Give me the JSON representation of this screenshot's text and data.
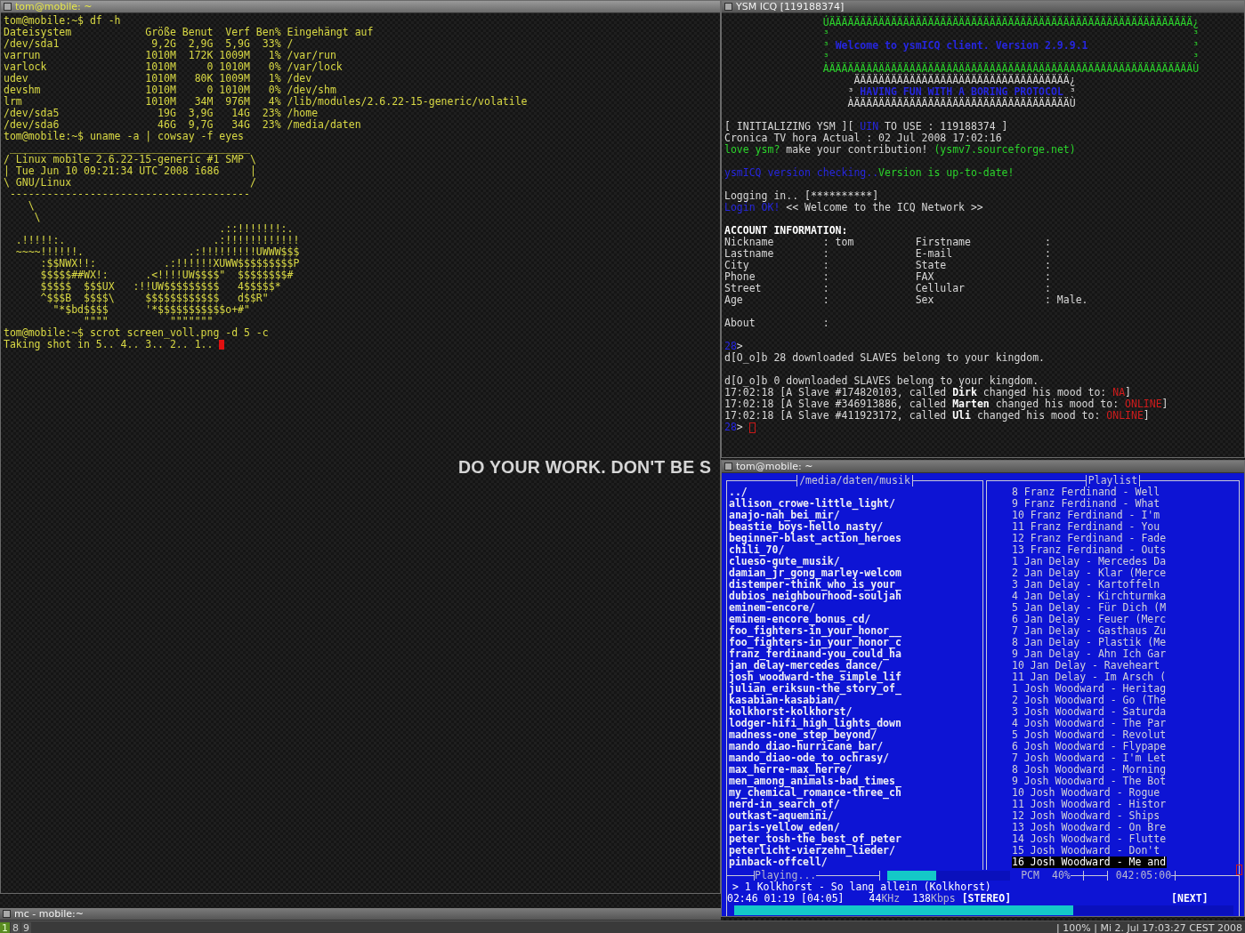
{
  "left_terminal": {
    "title": "tom@mobile: ~",
    "focused": true,
    "lines": [
      "tom@mobile:~$ df -h",
      "Dateisystem            Größe Benut  Verf Ben% Eingehängt auf",
      "/dev/sda1               9,2G  2,9G  5,9G  33% /",
      "varrun                 1010M  172K 1009M   1% /var/run",
      "varlock                1010M     0 1010M   0% /var/lock",
      "udev                   1010M   80K 1009M   1% /dev",
      "devshm                 1010M     0 1010M   0% /dev/shm",
      "lrm                    1010M   34M  976M   4% /lib/modules/2.6.22-15-generic/volatile",
      "/dev/sda5                19G  3,9G   14G  23% /home",
      "/dev/sda6                46G  9,7G   34G  23% /media/daten",
      "tom@mobile:~$ uname -a | cowsay -f eyes",
      " _______________________________________",
      "/ Linux mobile 2.6.22-15-generic #1 SMP \\",
      "| Tue Jun 10 09:21:34 UTC 2008 i686     |",
      "\\ GNU/Linux                             /",
      " ---------------------------------------",
      "    \\",
      "     \\",
      "                                   .::!!!!!!!:.",
      "  .!!!!!:.                        .:!!!!!!!!!!!!",
      "  ~~~~!!!!!!.                 .:!!!!!!!!!UWWW$$$",
      "      :$$NWX!!:           .:!!!!!!XUWW$$$$$$$$$P",
      "      $$$$$##WX!:      .<!!!!UW$$$$\"  $$$$$$$$#",
      "      $$$$$  $$$UX   :!!UW$$$$$$$$$   4$$$$$*",
      "      ^$$$B  $$$$\\     $$$$$$$$$$$$   d$$R\"",
      "        \"*$bd$$$$      '*$$$$$$$$$$$o+#\"",
      "             \"\"\"\"          \"\"\"\"\"\"\"",
      "tom@mobile:~$ scrot screen_voll.png -d 5 -c",
      "Taking shot in 5.. 4.. 3.. 2.. 1.. "
    ]
  },
  "wallpaper": {
    "slogan": "DO YOUR WORK. DON'T BE S"
  },
  "icq": {
    "title": "YSM ICQ [119188374]",
    "focused": false,
    "lines": [
      {
        "kind": "banner",
        "segments": [
          {
            "t": "                ÚÄÄÄÄÄÄÄÄÄÄÄÄÄÄÄÄÄÄÄÄÄÄÄÄÄÄÄÄÄÄÄÄÄÄÄÄÄÄÄÄÄÄÄÄÄÄÄÄÄÄÄÄÄÄÄÄÄÄÄ¿"
          }
        ]
      },
      {
        "kind": "banner",
        "segments": [
          {
            "t": "                ³                                                           ³"
          }
        ]
      },
      {
        "kind": "banner",
        "segments": [
          {
            "t": "                ³ "
          },
          {
            "t": "Welcome to ysmICQ client. Version 2.9.9.1",
            "color": "#2626e0",
            "bold": true
          },
          {
            "t": "                 ³"
          }
        ]
      },
      {
        "kind": "banner",
        "segments": [
          {
            "t": "                ³                                                           ³"
          }
        ]
      },
      {
        "kind": "banner",
        "segments": [
          {
            "t": "                ÀÄÄÄÄÄÄÄÄÄÄÄÄÄÄÄÄÄÄÄÄÄÄÄÄÄÄÄÄÄÄÄÄÄÄÄÄÄÄÄÄÄÄÄÄÄÄÄÄÄÄÄÄÄÄÄÄÄÄÄÙ"
          }
        ]
      },
      {
        "kind": "text",
        "segments": [
          {
            "t": "                     ÄÄÄÄÄÄÄÄÄÄÄÄÄÄÄÄÄÄÄÄÄÄÄÄÄÄÄÄÄÄÄÄÄÄÄ¿"
          }
        ]
      },
      {
        "kind": "text",
        "segments": [
          {
            "t": "                    ³ "
          },
          {
            "t": "HAVING FUN WITH A BORING PROTOCOL",
            "color": "#2626e0",
            "bold": true
          },
          {
            "t": " ³"
          }
        ]
      },
      {
        "kind": "text",
        "segments": [
          {
            "t": "                    ÀÄÄÄÄÄÄÄÄÄÄÄÄÄÄÄÄÄÄÄÄÄÄÄÄÄÄÄÄÄÄÄÄÄÄÄÙ"
          }
        ]
      },
      {
        "kind": "blank"
      },
      {
        "kind": "text",
        "segments": [
          {
            "t": "[ INITIALIZING YSM ][ "
          },
          {
            "t": "UIN",
            "color": "#2626e0"
          },
          {
            "t": " TO USE : 119188374 ]"
          }
        ]
      },
      {
        "kind": "text",
        "segments": [
          {
            "t": "Cronica TV hora Actual : 02 Jul 2008 17:02:16"
          }
        ]
      },
      {
        "kind": "text",
        "segments": [
          {
            "t": "love ysm?",
            "color": "#2bd42b"
          },
          {
            "t": " make your contribution! "
          },
          {
            "t": "(ysmv7.sourceforge.net)",
            "color": "#2bd42b"
          }
        ]
      },
      {
        "kind": "blank"
      },
      {
        "kind": "text",
        "segments": [
          {
            "t": "ysmICQ version checking..",
            "color": "#2626e0"
          },
          {
            "t": "Version is up-to-date!",
            "color": "#2bd42b"
          }
        ]
      },
      {
        "kind": "blank"
      },
      {
        "kind": "text",
        "segments": [
          {
            "t": "Logging in.. [**********]"
          }
        ]
      },
      {
        "kind": "text",
        "segments": [
          {
            "t": "Login OK!",
            "color": "#2626e0"
          },
          {
            "t": " << Welcome to the ICQ Network >>"
          }
        ]
      },
      {
        "kind": "blank"
      },
      {
        "kind": "heading",
        "text": "ACCOUNT INFORMATION:"
      },
      {
        "kind": "text",
        "segments": [
          {
            "t": "Nickname        : tom          Firstname            :"
          }
        ]
      },
      {
        "kind": "text",
        "segments": [
          {
            "t": "Lastname        :              E-mail               :"
          }
        ]
      },
      {
        "kind": "text",
        "segments": [
          {
            "t": "City            :              State                :"
          }
        ]
      },
      {
        "kind": "text",
        "segments": [
          {
            "t": "Phone           :              FAX                  :"
          }
        ]
      },
      {
        "kind": "text",
        "segments": [
          {
            "t": "Street          :              Cellular             :"
          }
        ]
      },
      {
        "kind": "text",
        "segments": [
          {
            "t": "Age             :              Sex                  : Male."
          }
        ]
      },
      {
        "kind": "blank"
      },
      {
        "kind": "text",
        "segments": [
          {
            "t": "About           :"
          }
        ]
      },
      {
        "kind": "blank"
      },
      {
        "kind": "text",
        "segments": [
          {
            "t": "28",
            "color": "#2626e0"
          },
          {
            "t": ">"
          }
        ]
      },
      {
        "kind": "text",
        "segments": [
          {
            "t": "d[O_o]b 28 downloaded SLAVES belong to your kingdom."
          }
        ]
      },
      {
        "kind": "blank"
      },
      {
        "kind": "text",
        "segments": [
          {
            "t": "d[O_o]b 0 downloaded SLAVES belong to your kingdom."
          }
        ]
      },
      {
        "kind": "text",
        "segments": [
          {
            "t": "17:02:18 [A Slave #174820103, called "
          },
          {
            "t": "Dirk",
            "bold": true,
            "color": "#ffffff"
          },
          {
            "t": " changed his mood to: "
          },
          {
            "t": "NA",
            "color": "#d01c1c"
          },
          {
            "t": "]"
          }
        ]
      },
      {
        "kind": "text",
        "segments": [
          {
            "t": "17:02:18 [A Slave #346913886, called "
          },
          {
            "t": "Marten",
            "bold": true,
            "color": "#ffffff"
          },
          {
            "t": " changed his mood to: "
          },
          {
            "t": "ONLINE",
            "color": "#d01c1c"
          },
          {
            "t": "]"
          }
        ]
      },
      {
        "kind": "text",
        "segments": [
          {
            "t": "17:02:18 [A Slave #411923172, called "
          },
          {
            "t": "Uli",
            "bold": true,
            "color": "#ffffff"
          },
          {
            "t": " changed his mood to: "
          },
          {
            "t": "ONLINE",
            "color": "#d01c1c"
          },
          {
            "t": "]"
          }
        ]
      },
      {
        "kind": "prompt",
        "segments": [
          {
            "t": "28",
            "color": "#2626e0"
          },
          {
            "t": "> "
          }
        ]
      }
    ]
  },
  "player": {
    "title": "tom@mobile: ~",
    "focused": false,
    "browser": {
      "path": "/media/daten/musik",
      "items": [
        "../",
        "allison_crowe-little_light/",
        "anajo-nah_bei_mir/",
        "beastie_boys-hello_nasty/",
        "beginner-blast_action_heroes",
        "chili_70/",
        "clueso-gute_musik/",
        "damian_jr_gong_marley-welcom",
        "distemper-think_who_is_your_",
        "dubios_neighbourhood-souljah",
        "eminem-encore/",
        "eminem-encore_bonus_cd/",
        "foo_fighters-in_your_honor__",
        "foo_fighters-in_your_honor_c",
        "franz_ferdinand-you_could_ha",
        "jan_delay-mercedes_dance/",
        "josh_woodward-the_simple_lif",
        "julian_eriksun-the_story_of_",
        "kasabian-kasabian/",
        "kolkhorst-kolkhorst/",
        "lodger-hifi_high_lights_down",
        "madness-one_step_beyond/",
        "mando_diao-hurricane_bar/",
        "mando_diao-ode_to_ochrasy/",
        "max_herre-max_herre/",
        "men_among_animals-bad_times_",
        "my_chemical_romance-three_ch",
        "nerd-in_search_of/",
        "outkast-aquemini/",
        "paris-yellow_eden/",
        "peter_tosh-the_best_of_peter",
        "peterlicht-vierzehn_lieder/",
        "pinback-offcell/"
      ]
    },
    "playlist": {
      "title": "Playlist",
      "items": [
        {
          "label": "8 Franz Ferdinand - Well",
          "selected": false
        },
        {
          "label": "9 Franz Ferdinand - What",
          "selected": false
        },
        {
          "label": "10 Franz Ferdinand - I'm",
          "selected": false
        },
        {
          "label": "11 Franz Ferdinand - You",
          "selected": false
        },
        {
          "label": "12 Franz Ferdinand - Fade",
          "selected": false
        },
        {
          "label": "13 Franz Ferdinand - Outs",
          "selected": false
        },
        {
          "label": "1 Jan Delay - Mercedes Da",
          "selected": false
        },
        {
          "label": "2 Jan Delay - Klar (Merce",
          "selected": false
        },
        {
          "label": "3 Jan Delay - Kartoffeln",
          "selected": false
        },
        {
          "label": "4 Jan Delay - Kirchturmka",
          "selected": false
        },
        {
          "label": "5 Jan Delay - Für Dich (M",
          "selected": false
        },
        {
          "label": "6 Jan Delay - Feuer (Merc",
          "selected": false
        },
        {
          "label": "7 Jan Delay - Gasthaus Zu",
          "selected": false
        },
        {
          "label": "8 Jan Delay - Plastik (Me",
          "selected": false
        },
        {
          "label": "9 Jan Delay - Ahn Ich Gar",
          "selected": false
        },
        {
          "label": "10 Jan Delay - Raveheart",
          "selected": false
        },
        {
          "label": "11 Jan Delay - Im Arsch (",
          "selected": false
        },
        {
          "label": "1 Josh Woodward - Heritag",
          "selected": false
        },
        {
          "label": "2 Josh Woodward - Go (The",
          "selected": false
        },
        {
          "label": "3 Josh Woodward - Saturda",
          "selected": false
        },
        {
          "label": "4 Josh Woodward - The Par",
          "selected": false
        },
        {
          "label": "5 Josh Woodward - Revolut",
          "selected": false
        },
        {
          "label": "6 Josh Woodward - Flypape",
          "selected": false
        },
        {
          "label": "7 Josh Woodward - I'm Let",
          "selected": false
        },
        {
          "label": "8 Josh Woodward - Morning",
          "selected": false
        },
        {
          "label": "9 Josh Woodward - The Bot",
          "selected": false
        },
        {
          "label": "10 Josh Woodward - Rogue",
          "selected": false
        },
        {
          "label": "11 Josh Woodward - Histor",
          "selected": false
        },
        {
          "label": "12 Josh Woodward - Ships",
          "selected": false
        },
        {
          "label": "13 Josh Woodward - On Bre",
          "selected": false
        },
        {
          "label": "14 Josh Woodward - Flutte",
          "selected": false
        },
        {
          "label": "15 Josh Woodward - Don't",
          "selected": false
        },
        {
          "label": "16 Josh Woodward - Me and",
          "selected": true
        }
      ]
    },
    "status": {
      "title": "Playing...",
      "volume": {
        "level": 0.4,
        "label": "PCM",
        "reading": "40%"
      },
      "total_time": "042:05:00",
      "now_playing": "> 1 Kolkhorst - So lang allein (Kolkhorst)",
      "times": "02:46 01:19 [04:05]",
      "frequency": "44",
      "frequency_unit": "KHz",
      "bitrate": "138",
      "bitrate_unit": "Kbps",
      "channels": "[STEREO]",
      "next": "[NEXT]",
      "progress": {
        "level": 0.68
      }
    }
  },
  "mc_window": {
    "title": "mc - mobile:~",
    "focused": false
  },
  "taskbar": {
    "workspaces": [
      {
        "label": "1",
        "selected": true
      },
      {
        "label": "8",
        "selected": false
      },
      {
        "label": "9",
        "selected": false
      }
    ],
    "status": "| 100% | Mi 2. Jul 17:03:27 CEST 2008"
  }
}
